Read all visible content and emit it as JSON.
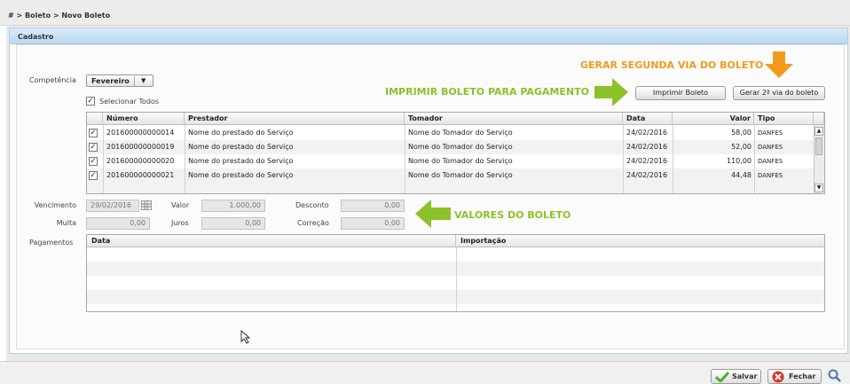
{
  "breadcrumb": "# > Boleto > Novo Boleto",
  "panel_title": "Cadastro",
  "competencia": {
    "label": "Competência",
    "value": "Fevereiro"
  },
  "select_all_label": "Selecionar Todos",
  "annotations": {
    "gerar": "GERAR SEGUNDA VIA DO BOLETO",
    "imprimir": "IMPRIMIR BOLETO PARA PAGAMENTO",
    "valores": "VALORES DO BOLETO"
  },
  "buttons": {
    "imprimir": "Imprimir Boleto",
    "gerar": "Gerar 2ª via do boleto"
  },
  "table": {
    "headers": [
      "Número",
      "Prestador",
      "Tomador",
      "Data",
      "Valor",
      "Tipo"
    ],
    "rows": [
      {
        "checked": "✓",
        "numero": "201600000000014",
        "prestador": "Nome do prestado do Serviço",
        "tomador": "Nome do Tomador do Serviço",
        "data": "24/02/2016",
        "valor": "58,00",
        "tipo": "DANFES"
      },
      {
        "checked": "✓",
        "numero": "201600000000019",
        "prestador": "Nome do prestado do Serviço",
        "tomador": "Nome do Tomador do Serviço",
        "data": "24/02/2016",
        "valor": "52,00",
        "tipo": "DANFES"
      },
      {
        "checked": "✓",
        "numero": "201600000000020",
        "prestador": "Nome do prestado do Serviço",
        "tomador": "Nome do Tomador do Serviço",
        "data": "24/02/2016",
        "valor": "110,00",
        "tipo": "DANFES"
      },
      {
        "checked": "✓",
        "numero": "201600000000021",
        "prestador": "Nome do prestado do Serviço",
        "tomador": "Nome do Tomador do Serviço",
        "data": "24/02/2016",
        "valor": "44,48",
        "tipo": "DANFES"
      }
    ]
  },
  "fields": {
    "vencimento": {
      "label": "Vencimento",
      "value": "29/02/2016"
    },
    "valor": {
      "label": "Valor",
      "value": "1.000,00"
    },
    "desconto": {
      "label": "Desconto",
      "value": "0,00"
    },
    "multa": {
      "label": "Multa",
      "value": "0,00"
    },
    "juros": {
      "label": "Juros",
      "value": "0,00"
    },
    "correcao": {
      "label": "Correção",
      "value": "0,00"
    }
  },
  "pagamentos": {
    "label": "Pagamentos",
    "headers": [
      "Data",
      "Importação"
    ]
  },
  "footer": {
    "salvar": "Salvar",
    "fechar": "Fechar"
  },
  "colors": {
    "annotation_orange": "#f39a1e",
    "annotation_green": "#8cc12a",
    "header_blue": "#b9d8ee"
  },
  "icons": [
    "checkbox-icon",
    "dropdown-arrow-icon",
    "calendar-icon",
    "scroll-up-icon",
    "scroll-down-icon",
    "mouse-cursor-icon",
    "save-check-icon",
    "close-icon",
    "zoom-icon"
  ]
}
